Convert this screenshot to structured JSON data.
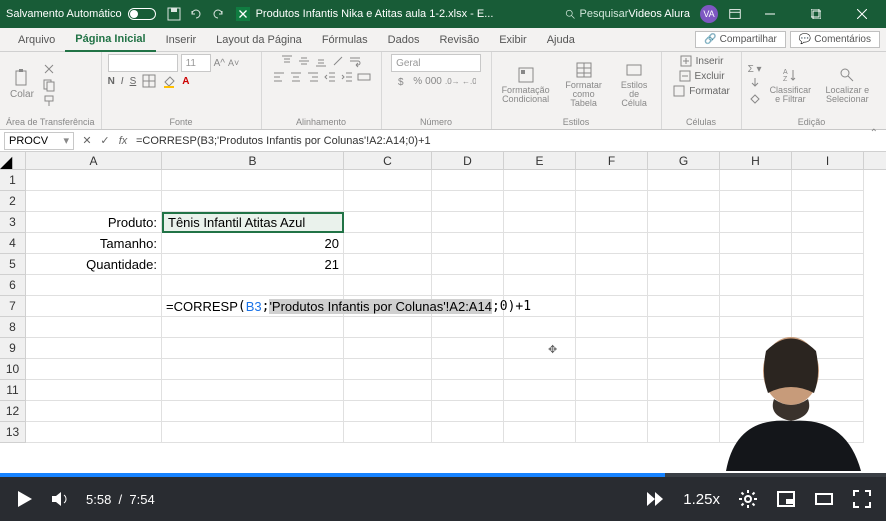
{
  "titlebar": {
    "autosave_label": "Salvamento Automático",
    "doc_name": "Produtos Infantis Nika e Atitas aula 1-2.xlsx - E...",
    "search_placeholder": "Pesquisar",
    "account_label": "Videos Alura",
    "avatar_initials": "VA"
  },
  "tabs": {
    "items": [
      "Arquivo",
      "Página Inicial",
      "Inserir",
      "Layout da Página",
      "Fórmulas",
      "Dados",
      "Revisão",
      "Exibir",
      "Ajuda"
    ],
    "active_index": 1,
    "share_label": "Compartilhar",
    "comments_label": "Comentários"
  },
  "ribbon": {
    "clipboard": {
      "paste_label": "Colar",
      "group_label": "Área de Transferência"
    },
    "font": {
      "family": "",
      "size": "11",
      "group_label": "Fonte",
      "buttons": [
        "N",
        "I",
        "S"
      ]
    },
    "alignment": {
      "group_label": "Alinhamento"
    },
    "number": {
      "format_label": "Geral",
      "group_label": "Número"
    },
    "styles": {
      "condfmt_label": "Formatação Condicional",
      "table_label": "Formatar como Tabela",
      "cellstyle_label": "Estilos de Célula",
      "group_label": "Estilos"
    },
    "cells": {
      "insert_label": "Inserir",
      "delete_label": "Excluir",
      "format_label": "Formatar",
      "group_label": "Células"
    },
    "editing": {
      "sort_label": "Classificar e Filtrar",
      "find_label": "Localizar e Selecionar",
      "group_label": "Edição"
    }
  },
  "formulabar": {
    "namebox_value": "PROCV",
    "formula_text": "=CORRESP(B3;'Produtos Infantis por Colunas'!A2:A14;0)+1"
  },
  "grid": {
    "columns": [
      "A",
      "B",
      "C",
      "D",
      "E",
      "F",
      "G",
      "H",
      "I"
    ],
    "rows": [
      1,
      2,
      3,
      4,
      5,
      6,
      7,
      8,
      9,
      10,
      11,
      12,
      13
    ],
    "cells": {
      "A3": "Produto:",
      "B3": "Tênis Infantil Atitas Azul",
      "A4": "Tamanho:",
      "B4": "20",
      "A5": "Quantidade:",
      "B5": "21"
    },
    "formula_cell": {
      "address": "B7",
      "prefix": "=",
      "fn": "CORRESP",
      "open": "(",
      "ref": "B3",
      "mid": ";",
      "range_text": "'Produtos Infantis por Colunas'!A2:A14",
      "suffix": ";0)+1"
    }
  },
  "video": {
    "current_time": "5:58",
    "total_time": "7:54",
    "speed_label": "1.25x",
    "progress_percent": 75
  }
}
